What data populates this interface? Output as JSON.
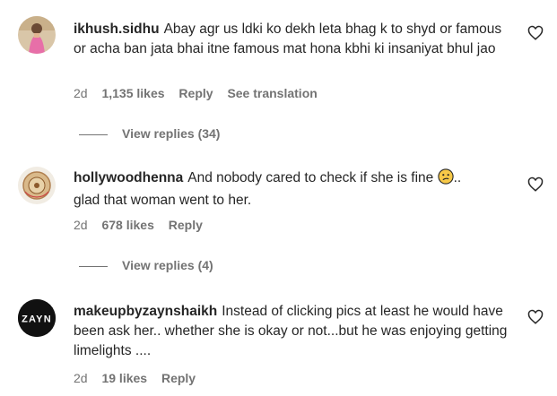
{
  "comments": [
    {
      "username": "ikhush.sidhu",
      "text": "Abay agr us ldki ko dekh leta bhag k to shyd or famous or acha ban jata bhai itne famous mat hona kbhi ki insaniyat bhul jao",
      "age": "2d",
      "likes": "1,135 likes",
      "reply_label": "Reply",
      "translation_label": "See translation",
      "view_replies": "View replies (34)"
    },
    {
      "username": "hollywoodhenna",
      "text": "And nobody cared to check if she is fine",
      "text_after_emoji": "..",
      "text_line2": "glad that woman went to her.",
      "age": "2d",
      "likes": "678 likes",
      "reply_label": "Reply",
      "view_replies": "View replies (4)"
    },
    {
      "username": "makeupbyzaynshaikh",
      "text": "Instead of clicking pics at least he would have been ask her.. whether she is okay or not...but he was enjoying getting limelights ....",
      "avatar_logo": "ZAYN",
      "age": "2d",
      "likes": "19 likes",
      "reply_label": "Reply"
    }
  ],
  "colors": {
    "text": "#262626",
    "secondary": "#737373",
    "background": "#ffffff"
  },
  "icons": {
    "like": "heart-icon",
    "emoji": "confused-face-emoji"
  }
}
